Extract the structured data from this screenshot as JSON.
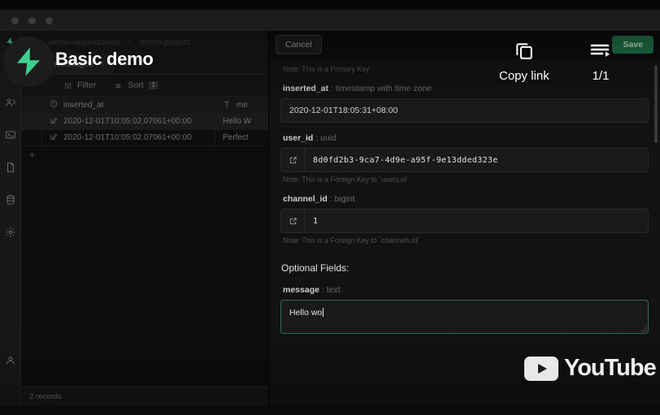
{
  "window": {
    "dots": [
      "close",
      "minimize",
      "maximize"
    ]
  },
  "video_overlay": {
    "title": "Basic demo",
    "copy_link_label": "Copy link",
    "page_indicator": "1/1",
    "brand": "YouTube",
    "logo_name": "supabase-logo"
  },
  "breadcrumb": {
    "organization": "demo-organization",
    "separator": ">",
    "project": "demo-project"
  },
  "tabs": [
    {
      "label": "messages",
      "close": "×"
    }
  ],
  "tab_add": "+",
  "toolbar": {
    "filter_label": "Filter",
    "sort_label": "Sort",
    "sort_count": "1"
  },
  "grid": {
    "columns": [
      {
        "label": "inserted_at",
        "icon": "clock-icon"
      },
      {
        "label": "me",
        "icon": "text-type-icon"
      }
    ],
    "rows": [
      {
        "inserted_at": "2020-12-01T10:05:02.07061+00:00",
        "message": "Hello W"
      },
      {
        "inserted_at": "2020-12-01T10:05:02.07061+00:00",
        "message": "Perfect"
      }
    ],
    "add_row": "+"
  },
  "statusbar": {
    "records": "2 records"
  },
  "panel": {
    "cancel_label": "Cancel",
    "save_label": "Save",
    "primary_key_note": "Note: This is a Primary Key",
    "fields": [
      {
        "name": "inserted_at",
        "type": "timestamp with time zone",
        "value": "2020-12-01T18:05:31+08:00",
        "note": ""
      },
      {
        "name": "user_id",
        "type": "uuid",
        "value": "8d0fd2b3-9ca7-4d9e-a95f-9e13dded323e",
        "note": "Note: This is a Foreign Key to `users.id`"
      },
      {
        "name": "channel_id",
        "type": "bigint",
        "value": "1",
        "note": "Note: This is a Foreign Key to `channels.id`"
      }
    ],
    "optional_title": "Optional Fields:",
    "optional_field": {
      "name": "message",
      "type": "text",
      "value": "Hello wo"
    }
  },
  "colors": {
    "brand_green": "#3ecf8e",
    "save_green": "#1e6b44",
    "focus_border": "#2f6e55"
  }
}
